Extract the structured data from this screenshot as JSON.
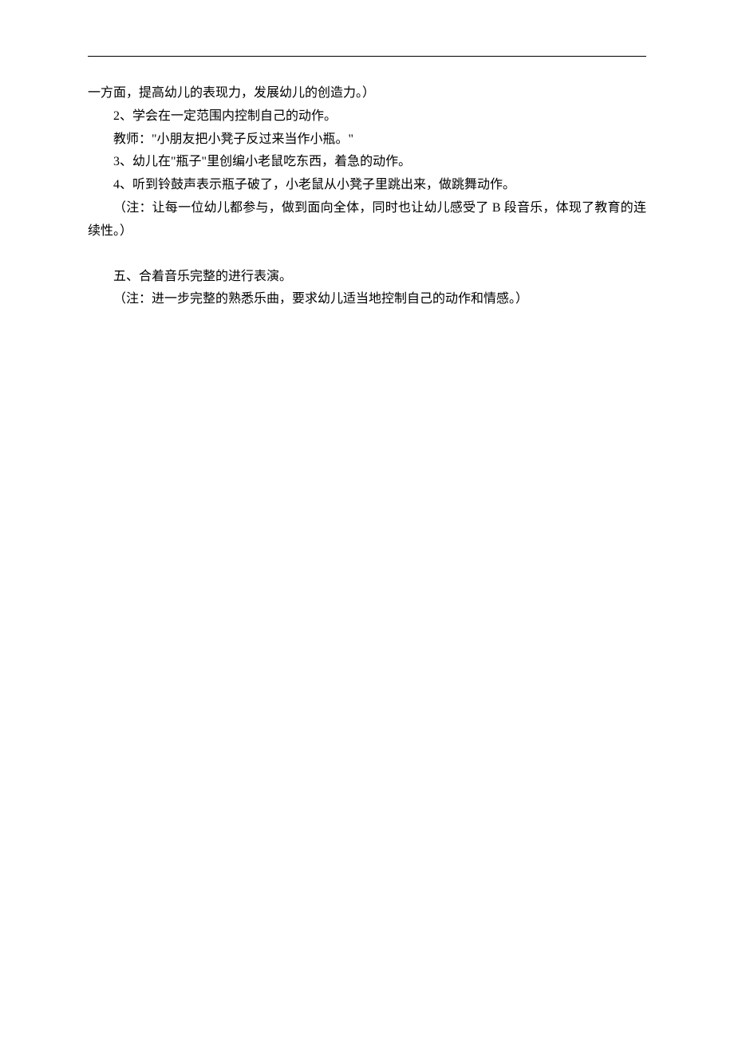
{
  "content": {
    "line1": "一方面，提高幼儿的表现力，发展幼儿的创造力。）",
    "line2": "2、学会在一定范围内控制自己的动作。",
    "line3": "教师：\"小朋友把小凳子反过来当作小瓶。\"",
    "line4": "3、幼儿在\"瓶子\"里创编小老鼠吃东西，着急的动作。",
    "line5": "4、听到铃鼓声表示瓶子破了，小老鼠从小凳子里跳出来，做跳舞动作。",
    "line6": "（注：让每一位幼儿都参与，做到面向全体，同时也让幼儿感受了 B 段音乐，体现了教育的连续性。）",
    "line7": "五、合着音乐完整的进行表演。",
    "line8": "（注：进一步完整的熟悉乐曲，要求幼儿适当地控制自己的动作和情感。）"
  }
}
